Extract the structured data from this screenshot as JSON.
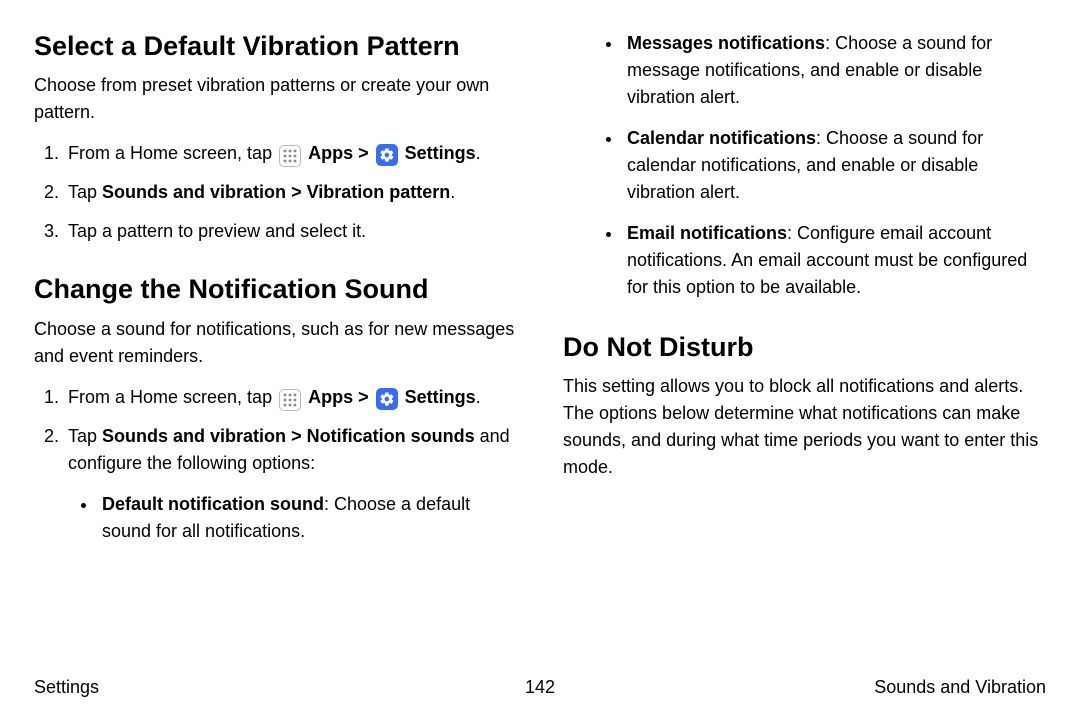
{
  "left": {
    "section1": {
      "heading": "Select a Default Vibration Pattern",
      "intro": "Choose from preset vibration patterns or create your own pattern.",
      "step1a": "From a Home screen, tap ",
      "apps": "Apps",
      "settings": "Settings",
      "step2a": "Tap ",
      "step2b": "Sounds and vibration",
      "step2c": "Vibration pattern",
      "step3": "Tap a pattern to preview and select it."
    },
    "section2": {
      "heading": "Change the Notification Sound",
      "intro": "Choose a sound for notifications, such as for new messages and event reminders.",
      "step1a": "From a Home screen, tap ",
      "apps": "Apps",
      "settings": "Settings",
      "step2a": "Tap ",
      "step2b": "Sounds and vibration",
      "step2c": "Notification sounds",
      "step2d": " and configure the following options:",
      "b1a": "Default notification sound",
      "b1b": ": Choose a default sound for all notifications."
    }
  },
  "right": {
    "b2a": "Messages notifications",
    "b2b": ": Choose a sound for message notifications, and enable or disable vibration alert.",
    "b3a": "Calendar notifications",
    "b3b": ": Choose a sound for calendar notifications, and enable or disable vibration alert.",
    "b4a": "Email notifications",
    "b4b": ": Configure email account notifications. An email account must be configured for this option to be available.",
    "section3": {
      "heading": "Do Not Disturb",
      "intro": "This setting allows you to block all notifications and alerts. The options below determine what notifications can make sounds, and during what time periods you want to enter this mode."
    }
  },
  "footer": {
    "left": "Settings",
    "center": "142",
    "right": "Sounds and Vibration"
  },
  "glyphs": {
    "chevron": ">",
    "period": "."
  }
}
